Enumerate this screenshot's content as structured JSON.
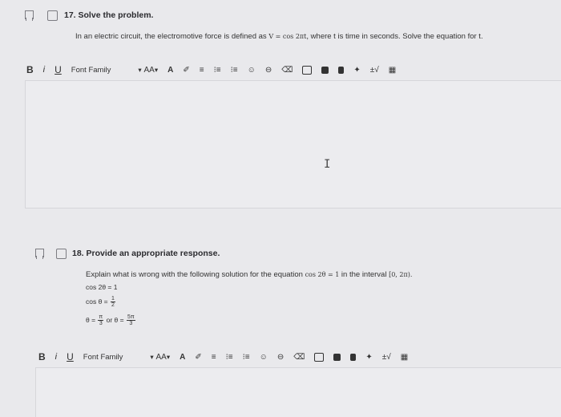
{
  "q17": {
    "number_title": "17. Solve the problem.",
    "prompt_before": "In an electric circuit, the electromotive force is defined as ",
    "prompt_math": "V = cos 2πt",
    "prompt_after": ", where t is time in seconds. Solve the equation for t."
  },
  "q18": {
    "number_title": "18. Provide an appropriate response.",
    "prompt_before": "Explain what is wrong with the following solution for the equation ",
    "prompt_math": "cos 2θ = 1",
    "prompt_mid": " in the interval ",
    "prompt_interval": "[0, 2π).",
    "step1": "cos 2θ = 1",
    "step2_lhs": "cos θ = ",
    "step2_num": "1",
    "step2_den": "2",
    "step3_lhs": "θ = ",
    "step3_num1": "π",
    "step3_den1": "3",
    "step3_or": " or θ = ",
    "step3_num2": "5π",
    "step3_den2": "3"
  },
  "toolbar": {
    "bold": "B",
    "italic": "i",
    "underline": "U",
    "font_family": "Font Family",
    "font_size": "AA",
    "dropdown_arrow": "▾"
  },
  "icons": {
    "font_color": "A",
    "highlight": "✐",
    "align": "≡",
    "list_numbered": "⁝≡",
    "list_bulleted": "⁝≡",
    "emoji": "☺",
    "link": "⊖",
    "eraser": "⌫",
    "sqrt": "±√",
    "table": "▦"
  }
}
